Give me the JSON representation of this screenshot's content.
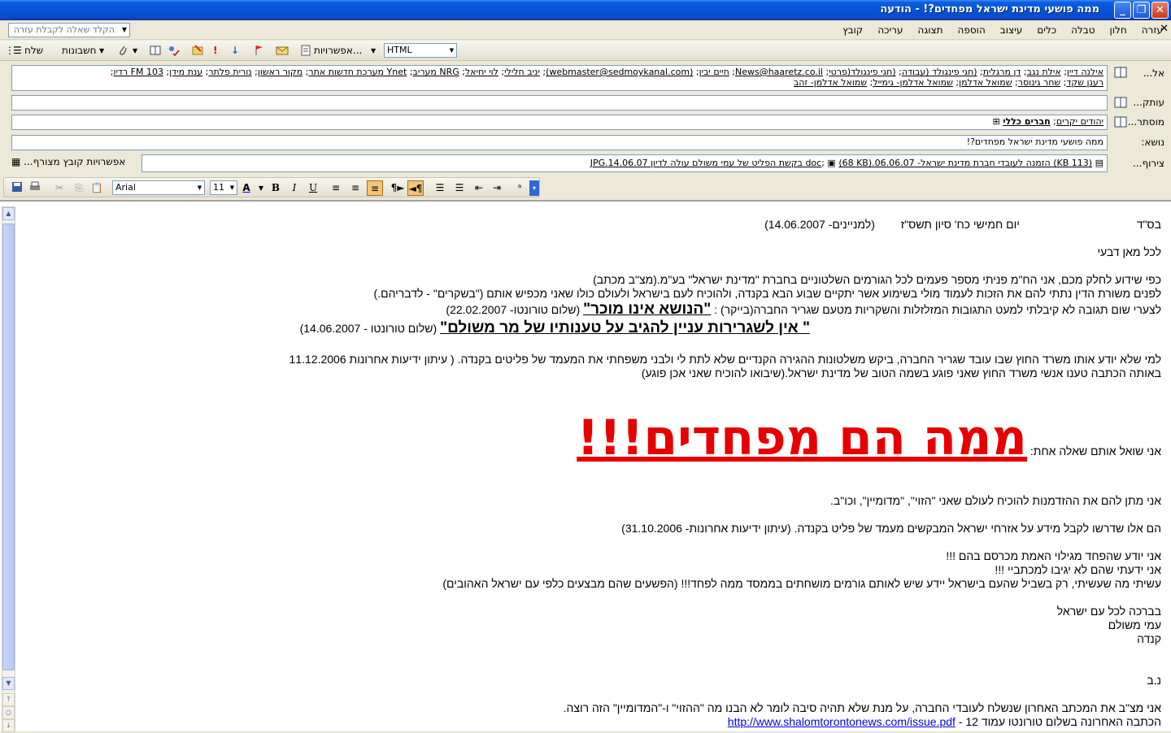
{
  "window": {
    "title": "ממה פושעי מדינת ישראל מפחדים?! - הודעה",
    "controls": [
      "_",
      "❐",
      "✕"
    ]
  },
  "menu": {
    "items": [
      "קובץ",
      "עריכה",
      "תצוגה",
      "הוספה",
      "עיצוב",
      "כלים",
      "טבלה",
      "חלון",
      "עזרה"
    ],
    "help_placeholder": "הקלד שאלה לקבלת עזרה"
  },
  "toolbar": {
    "send": "שלח",
    "accounts": "חשבונות",
    "options": "אפשרויות...",
    "format": "HTML"
  },
  "header": {
    "to_label": "אל...",
    "cc_label": "עותק...",
    "bcc_label": "מוסתר...",
    "subject_label": "נושא:",
    "attach_label": "צירוף...",
    "to_recipients": [
      "אילנה דיין",
      "אילת נגב",
      "דן מרגלית",
      "(חגי פינגולד (עבודה",
      "(חגי פינגולד(פרטי",
      "News@haaretz.co.il",
      "חיים יבין",
      "(webmaster@sedmoykanal.com)",
      "יניב חלילי",
      "לוי יחיאל",
      "NRG מעריב",
      "Ynet מערכת חדשות אתר",
      "מקור ראשון",
      "נורית פלתר",
      "ענת מידן",
      "103 FM רדיו",
      "רענן שקד",
      "שחר גינוסר",
      "שמואל אדלמן",
      "שמואל אדלמן- גימייל",
      "שמואל אדלמן- זהב"
    ],
    "bcc_recipients": [
      "יהודים יקרים",
      "חברים כללי"
    ],
    "subject": "ממה פושעי מדינת ישראל מפחדים?!",
    "attachments": [
      "(113 KB) הזמנה לעובדי חברת מדינת ישראל- 06.06.07.doc",
      "(68 KB) בקשת הפליט של עמי משולם עולה לדיון 14.06.07.JPG"
    ],
    "attach_options": "אפשרויות קובץ מצורף..."
  },
  "format_bar": {
    "font": "Arial",
    "size": "11"
  },
  "body": {
    "l1a": "בס\"ד",
    "l1b": "יום חמישי כח' סיון תשס\"ז",
    "l1c": "(למניינים- 14.06.2007)",
    "l2": "לכל מאן דבעי",
    "l3": "כפי שידוע לחלק מכם, אני הח\"מ פניתי מספר פעמים לכל הגורמים השלטוניים בחברת \"מדינת ישראל\" בע\"מ.(מצ\"ב מכתב)",
    "l4": "לפנים משורת הדין נתתי להם את הזכות לעמוד מולי בשימוע אשר יתקיים שבוע הבא בקנדה, ולהוכיח לעם בישראל ולעולם כולו שאני מכפיש אותם (\"בשקרים\" - לדבריהם.)",
    "l5a": "לצערי שום תגובה לא קיבלתי למעט התגובות המזלזלות והשקריות מטעם שגריר החברה(בייקר) :",
    "l5b": "\"הנושא אינו מוכר\"",
    "l5c": "(שלום טורונטו- 22.02.2007)",
    "l6a": "\" אין לשגרירות עניין להגיב על טענותיו של מר משולם\"",
    "l6b": "(שלום טורונטו - 14.06.2007)",
    "l7": "למי שלא יודע אותו משרד החוץ שבו עובד שגריר החברה, ביקש משלטונות ההגירה הקנדיים שלא לתת לי ולבני משפחתי את המעמד של פליטים בקנדה. ( עיתון ידיעות אחרונות 11.12.2006",
    "l8": "באותה הכתבה טענו אנשי משרד החוץ שאני פוגע בשמה הטוב של מדינת ישראל.(שיבואו להוכיח שאני אכן פוגע)",
    "l9a": "אני שואל אותם שאלה אחת:",
    "headline": "ממה הם מפחדים!!!",
    "l10": "אני מתן להם את ההזדמנות להוכיח לעולם שאני \"הזוי\", \"מדומיין\", וכו\"ב.",
    "l11": "הם אלו שדרשו לקבל מידע על אזרחי ישראל המבקשים מעמד של פליט בקנדה. (עיתון ידיעות אחרונות- 31.10.2006)",
    "l12": "אני יודע שהפחד מגילוי האמת מכרסם בהם !!!",
    "l13": "אני ידעתי שהם לא יגיבו למכתביי !!!",
    "l14": "עשיתי מה שעשיתי, רק בשביל שהעם בישראל יידע שיש לאותם גורמים מושחתים בממסד ממה לפחד!!! (הפשעים שהם מבצעים כלפי עם ישראל האהובים)",
    "l15": "בברכה לכל עם ישראל",
    "l16": "עמי משולם",
    "l17": "קנדה",
    "l18": "נ.ב",
    "l19": "אני מצ\"ב את המכתב האחרון שנשלח לעובדי החברה, על מנת שלא תהיה סיבה לומר לא הבנו מה \"ההזוי\" ו-\"המדומיין\" הזה רוצה.",
    "l20a": "הכתבה האחרונה בשלום טורונטו עמוד 12 -",
    "l20b": "http://www.shalomtorontonews.com/issue.pdf"
  }
}
